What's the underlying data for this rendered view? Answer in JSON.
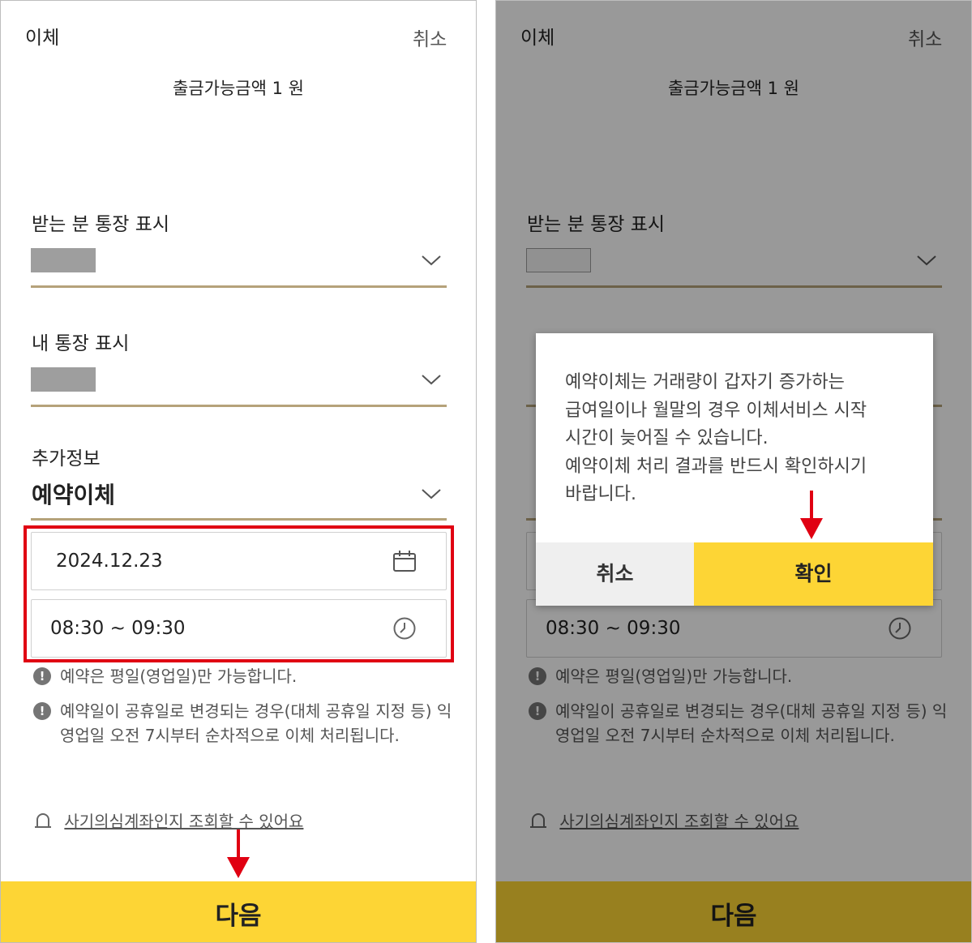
{
  "screens": [
    {
      "header": {
        "title": "이체",
        "cancel": "취소"
      },
      "balance": "출금가능금액 1 원",
      "recipient_display": {
        "label": "받는 분 통장 표시"
      },
      "my_display": {
        "label": "내 통장 표시"
      },
      "extra_info": {
        "label": "추가정보",
        "value": "예약이체"
      },
      "date": {
        "value": "2024.12.23",
        "icon": "calendar-icon"
      },
      "time": {
        "value": "08:30 ~ 09:30",
        "icon": "clock-icon"
      },
      "notices": [
        {
          "text": "예약은 평일(영업일)만 가능합니다."
        },
        {
          "line1": "예약일이 공휴일로 변경되는 경우(대체 공휴일 지정 등) 익",
          "line2": "영업일 오전 7시부터 순차적으로 이체 처리됩니다."
        }
      ],
      "fraud_link": "사기의심계좌인지 조회할 수 있어요",
      "next_button": "다음"
    },
    {
      "header": {
        "title": "이체",
        "cancel": "취소"
      },
      "balance": "출금가능금액 1 원",
      "recipient_display": {
        "label": "받는 분 통장 표시"
      },
      "time": {
        "value": "08:30 ~ 09:30"
      },
      "notices": [
        {
          "text": "예약은 평일(영업일)만 가능합니다."
        },
        {
          "line1": "예약일이 공휴일로 변경되는 경우(대체 공휴일 지정 등) 익",
          "line2": "영업일 오전 7시부터 순차적으로 이체 처리됩니다."
        }
      ],
      "fraud_link": "사기의심계좌인지 조회할 수 있어요",
      "next_button": "다음",
      "dialog": {
        "lines": [
          "예약이체는 거래량이 갑자기 증가하는",
          "급여일이나 월말의 경우 이체서비스 시작",
          "시간이 늦어질 수 있습니다.",
          "예약이체 처리 결과를 반드시 확인하시기",
          "바랍니다."
        ],
        "cancel": "취소",
        "confirm": "확인"
      }
    }
  ],
  "colors": {
    "accent": "#fdd535",
    "underline": "#b5a27a",
    "highlight": "#e00012",
    "arrow": "#e00012"
  }
}
